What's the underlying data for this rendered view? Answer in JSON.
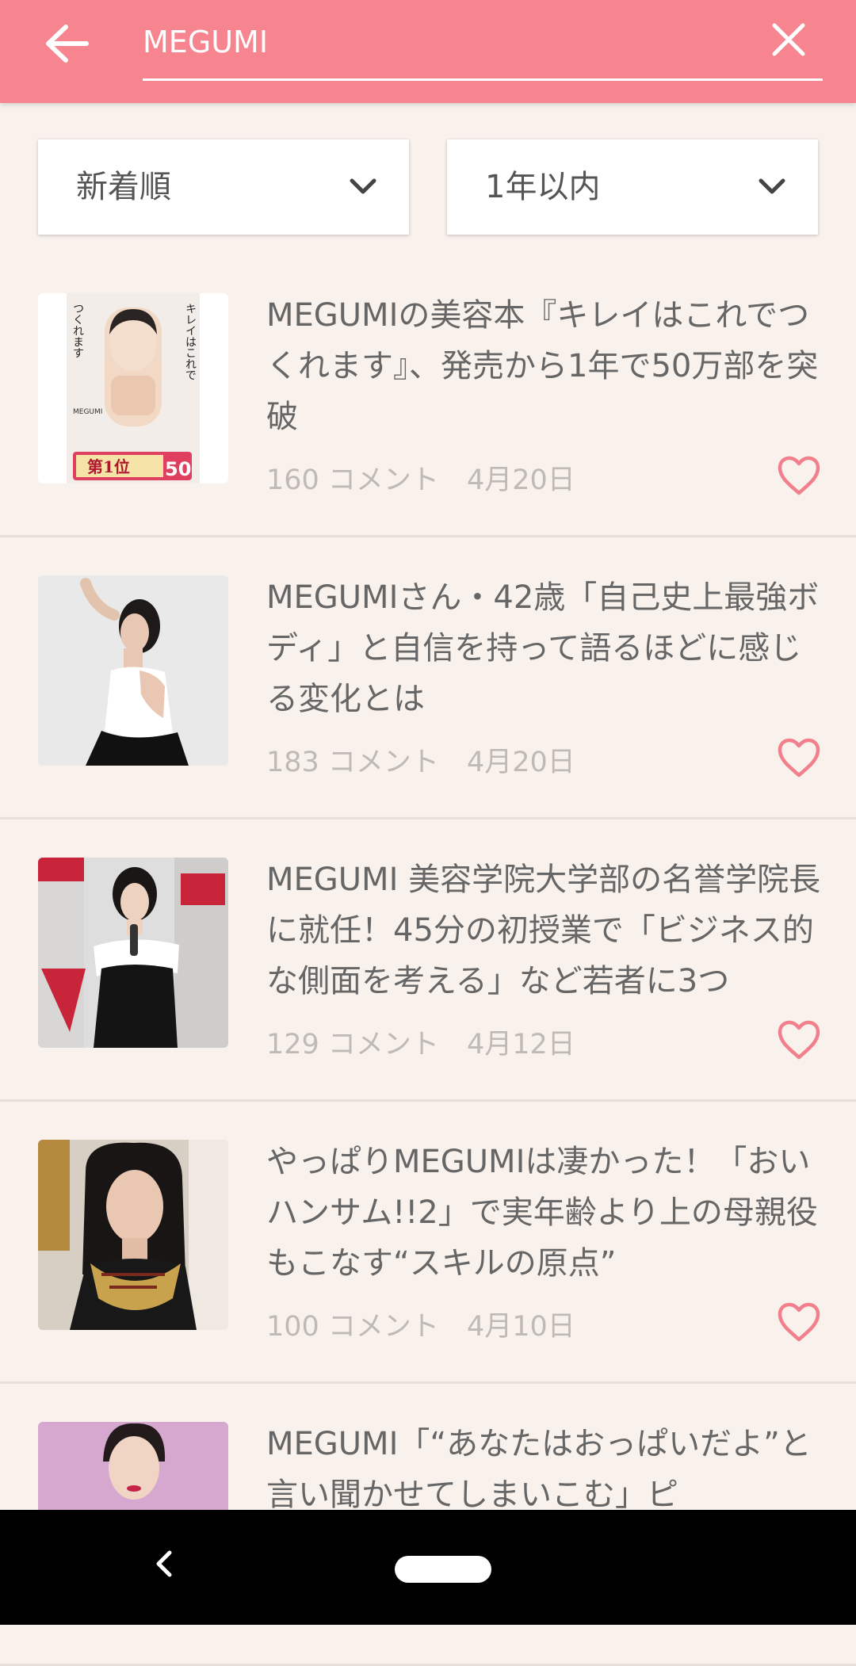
{
  "search": {
    "query": "MEGUMI"
  },
  "filters": {
    "sort": "新着順",
    "period": "1年以内"
  },
  "articles": [
    {
      "title": "MEGUMIの美容本『キレイはこれでつくれます』、発売から1年で50万部を突破",
      "comments": "160 コメント",
      "date": "4月20日"
    },
    {
      "title": "MEGUMIさん・42歳「自己史上最強ボディ」と自信を持って語るほどに感じる変化とは",
      "comments": "183 コメント",
      "date": "4月20日"
    },
    {
      "title": "MEGUMI 美容学院大学部の名誉学院長に就任！45分の初授業で「ビジネス的な側面を考える」など若者に3つ",
      "comments": "129 コメント",
      "date": "4月12日"
    },
    {
      "title": "やっぱりMEGUMIは凄かった！「おいハンサム!!2」で実年齢より上の母親役もこなす“スキルの原点”",
      "comments": "100 コメント",
      "date": "4月10日"
    },
    {
      "title": "MEGUMI「“あなたはおっぱいだよ”と言い聞かせてしまいこむ」ピ",
      "comments": "",
      "date": ""
    }
  ],
  "book_cover": {
    "title_line1": "キレイはこれで",
    "title_line2": "つくれます",
    "author": "MEGUMI",
    "badge_rank": "第1位",
    "badge_count": "50"
  },
  "colors": {
    "header": "#f6858f",
    "background": "#f8f1ec",
    "heart": "#f27f8c",
    "title_text": "#666666",
    "meta_text": "#c0bab6"
  },
  "icons": {
    "back": "arrow-left-icon",
    "clear": "close-icon",
    "dropdown": "chevron-down-icon",
    "favorite": "heart-outline-icon"
  }
}
